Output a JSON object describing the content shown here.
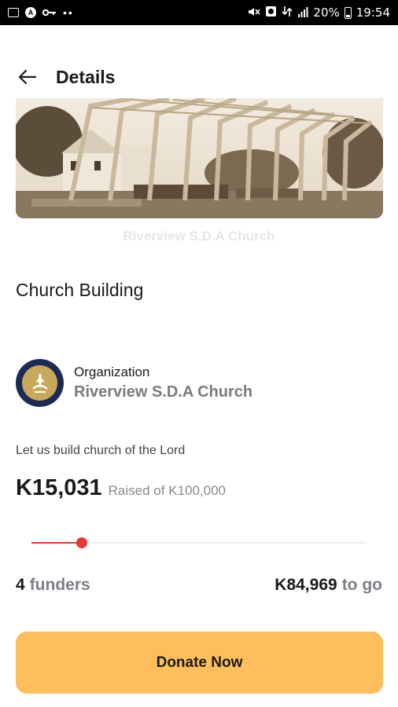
{
  "status_bar": {
    "battery": "20%",
    "time": "19:54",
    "left_icons": [
      "image-icon",
      "a-icon",
      "key-icon",
      "more-dots-icon"
    ],
    "right_icons": [
      "mute-icon",
      "alarm-icon",
      "data-signal-icon",
      "signal-icon",
      "battery-icon"
    ]
  },
  "header": {
    "title": "Details",
    "back_icon": "arrow-left-icon"
  },
  "hero": {
    "watermark": "Riverview S.D.A Church"
  },
  "campaign": {
    "title": "Church Building",
    "description": "Let us build church of the Lord",
    "raised": "K15,031",
    "raised_of": "Raised of K100,000",
    "progress_fraction": 0.15031,
    "funders_count": "4",
    "funders_label": "funders",
    "remaining": "K84,969",
    "remaining_label": "to go"
  },
  "organization": {
    "label": "Organization",
    "name": "Riverview S.D.A Church"
  },
  "actions": {
    "donate_label": "Donate Now"
  },
  "colors": {
    "accent": "#ffbe5c",
    "progress": "#e53935",
    "muted": "#7b8087"
  }
}
